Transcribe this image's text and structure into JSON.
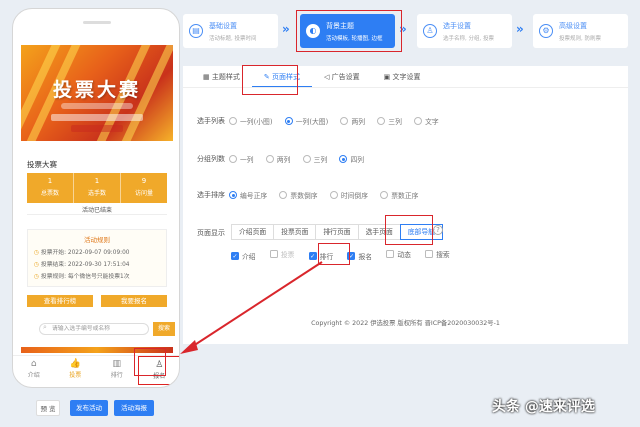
{
  "phone": {
    "banner_title": "投票大赛",
    "event_title": "投票大赛",
    "stats": [
      {
        "num": "1",
        "label": "总票数"
      },
      {
        "num": "1",
        "label": "选手数"
      },
      {
        "num": "9",
        "label": "访问量"
      }
    ],
    "ended": "活动已结束",
    "rules_title": "活动规则",
    "rules": [
      "投票开始: 2022-09-07 09:09:00",
      "投票结束: 2022-09-30 17:51:04",
      "投票规则: 每个微信号只能投票1次"
    ],
    "btn_rank": "查看排行榜",
    "btn_signup": "我要报名",
    "search_placeholder": "请输入选手编号或名称",
    "search_btn": "搜索",
    "tabbar": [
      "介绍",
      "投票",
      "排行",
      "报名"
    ]
  },
  "bottom": {
    "preview": "预 览",
    "publish": "发布活动",
    "save": "活动海报"
  },
  "steps": [
    {
      "title": "基础设置",
      "desc": "活动标题, 投票时间"
    },
    {
      "title": "背景主题",
      "desc": "活动模板, 轮播图, 边框"
    },
    {
      "title": "选手设置",
      "desc": "选手名称, 分组, 投票"
    },
    {
      "title": "高级设置",
      "desc": "投票规则, 防刷票"
    }
  ],
  "tabs": [
    "主题样式",
    "页面样式",
    "广告设置",
    "文字设置"
  ],
  "form": {
    "layout_label": "选手列表",
    "layout_options": [
      "一列(小图)",
      "一列(大图)",
      "两列",
      "三列",
      "文字"
    ],
    "group_label": "分组列数",
    "group_options": [
      "一列",
      "两列",
      "三列",
      "四列"
    ],
    "sort_label": "选手排序",
    "sort_options": [
      "编号正序",
      "票数倒序",
      "时间倒序",
      "票数正序"
    ],
    "display_label": "页面显示",
    "display_segments": [
      "介绍页面",
      "投票页面",
      "排行页面",
      "选手页面",
      "底部导航"
    ],
    "checkboxes": [
      {
        "label": "介绍",
        "checked": true
      },
      {
        "label": "投票",
        "checked": false
      },
      {
        "label": "排行",
        "checked": true
      },
      {
        "label": "报名",
        "checked": true
      },
      {
        "label": "动态",
        "checked": false
      },
      {
        "label": "搜索",
        "checked": false
      }
    ]
  },
  "copyright": "Copyright © 2022 伊选投票 版权所有 晋ICP备2020030032号-1",
  "watermark": "头条 @速来评选",
  "colors": {
    "accent": "#2e7ef3",
    "banner": "#f0a92a",
    "highlight": "#d9262c"
  }
}
